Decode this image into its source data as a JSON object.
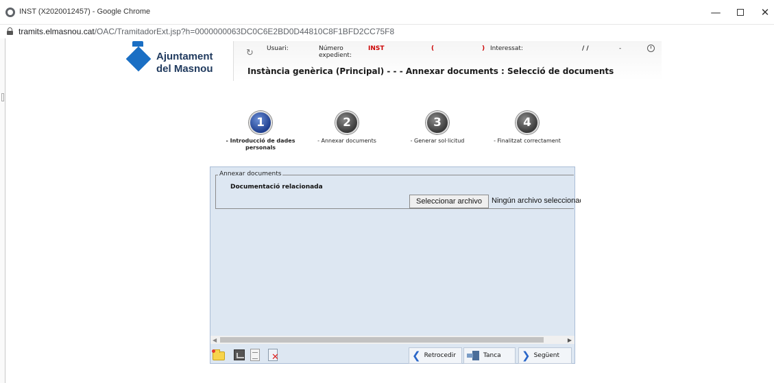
{
  "window": {
    "title": "INST (X2020012457) - Google Chrome",
    "min": "—",
    "close": "✕"
  },
  "address": {
    "domain": "tramits.elmasnou.cat",
    "path": "/OAC/TramitadorExt.jsp?h=0000000063DC0C6E2BD0D44810C8F1BFD2CC75F8"
  },
  "logo": {
    "line1": "Ajuntament",
    "line2": "del Masnou"
  },
  "header": {
    "usuari_label": "Usuari:",
    "numero_label1": "Número",
    "numero_label2": "expedient:",
    "inst_value": "INST",
    "paren_open": "(",
    "paren_close": ")",
    "interessat_label": "Interessat:",
    "date_value": "/ /",
    "dash": "-",
    "title": "Instància genèrica (Principal) - - - Annexar documents : Selecció de documents"
  },
  "steps": [
    {
      "number": "1",
      "label": "- Introducció de dades personals",
      "active": true
    },
    {
      "number": "2",
      "label": "- Annexar documents",
      "active": false
    },
    {
      "number": "3",
      "label": "- Generar sol·licitud",
      "active": false
    },
    {
      "number": "4",
      "label": "- Finalitzat correctament",
      "active": false
    }
  ],
  "panel": {
    "legend": "Annexar documents",
    "doc_label": "Documentació relacionada",
    "file_button": "Seleccionar archivo",
    "file_status": "Ningún archivo seleccionado"
  },
  "toolbar": {
    "back": "Retrocedir",
    "close": "Tanca",
    "next": "Següent"
  },
  "colors": {
    "panel_bg": "#dde7f2",
    "accent_blue": "#2a66c8",
    "header_red": "#cc0000",
    "brand_blue": "#1a6fc4"
  },
  "icons": [
    "globe-icon",
    "lock-icon",
    "clock-icon",
    "folder-new-icon",
    "image-icon",
    "document-icon",
    "delete-document-icon",
    "chevron-left-icon",
    "exit-door-icon",
    "chevron-right-icon"
  ]
}
